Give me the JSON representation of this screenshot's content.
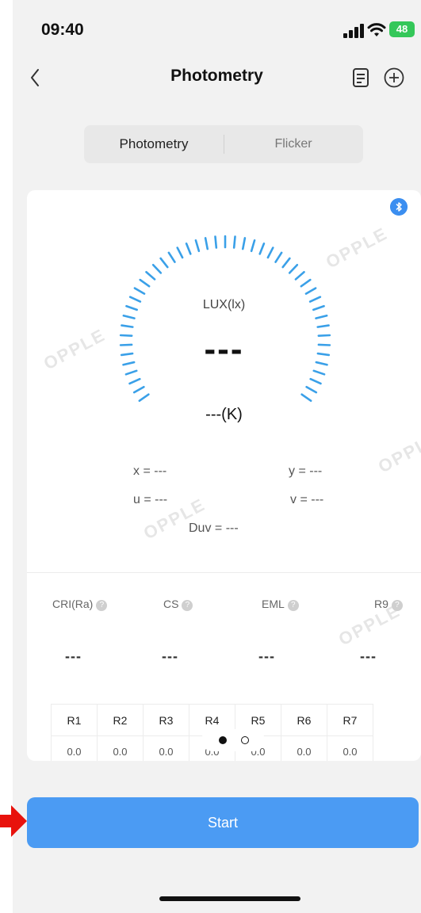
{
  "status_bar": {
    "time": "09:40",
    "battery": "48"
  },
  "header": {
    "title": "Photometry"
  },
  "tabs": [
    {
      "label": "Photometry",
      "active": true
    },
    {
      "label": "Flicker",
      "active": false
    }
  ],
  "watermark": "OPPLE",
  "gauge": {
    "lux_label": "LUX(lx)",
    "lux_value": "---",
    "cct_value": "---(K)"
  },
  "coordinates": {
    "x": "x = ---",
    "y": "y = ---",
    "u": "u = ---",
    "v": "v = ---",
    "duv": "Duv = ---"
  },
  "metrics": [
    {
      "label": "CRI(Ra)",
      "value": "---"
    },
    {
      "label": "CS",
      "value": "---"
    },
    {
      "label": "EML",
      "value": "---"
    },
    {
      "label": "R9",
      "value": "---"
    }
  ],
  "r_table": {
    "headers": [
      "R1",
      "R2",
      "R3",
      "R4",
      "R5",
      "R6",
      "R7"
    ],
    "values": [
      "0.0",
      "0.0",
      "0.0",
      "0.0",
      "0.0",
      "0.0",
      "0.0"
    ]
  },
  "start_button": {
    "label": "Start"
  },
  "colors": {
    "accent": "#4b9bf3",
    "gauge": "#3aa0e8",
    "battery": "#34c759",
    "arrow": "#e8120c"
  }
}
